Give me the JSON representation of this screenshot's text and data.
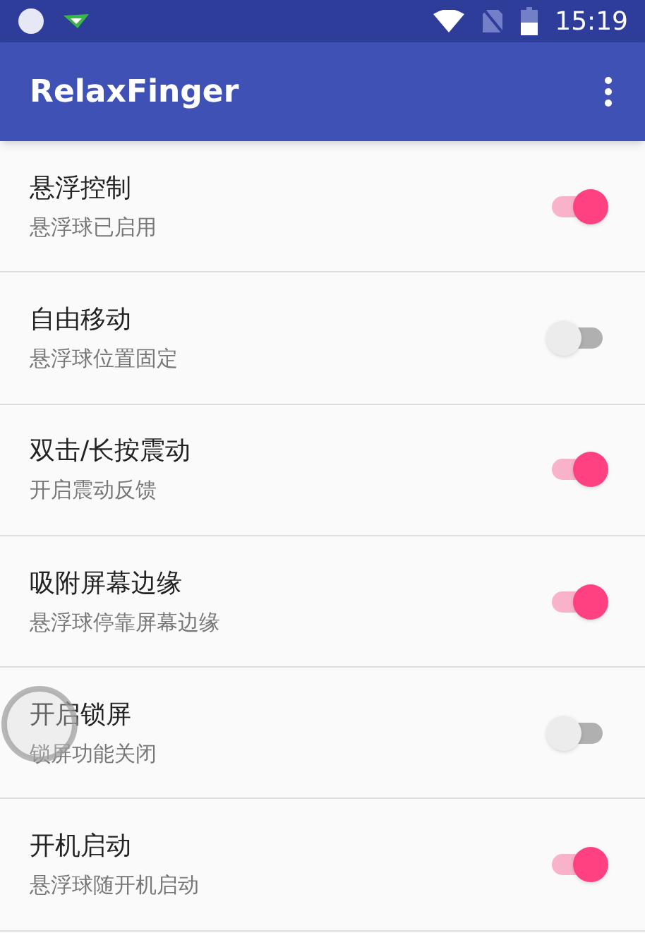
{
  "status_bar": {
    "time": "15:19"
  },
  "app_bar": {
    "title": "RelaxFinger"
  },
  "settings": [
    {
      "title": "悬浮控制",
      "summary": "悬浮球已启用",
      "on": true
    },
    {
      "title": "自由移动",
      "summary": "悬浮球位置固定",
      "on": false
    },
    {
      "title": "双击/长按震动",
      "summary": "开启震动反馈",
      "on": true
    },
    {
      "title": "吸附屏幕边缘",
      "summary": "悬浮球停靠屏幕边缘",
      "on": true
    },
    {
      "title": "开启锁屏",
      "summary": "锁屏功能关闭",
      "on": false
    },
    {
      "title": "开机启动",
      "summary": "悬浮球随开机启动",
      "on": true
    }
  ]
}
